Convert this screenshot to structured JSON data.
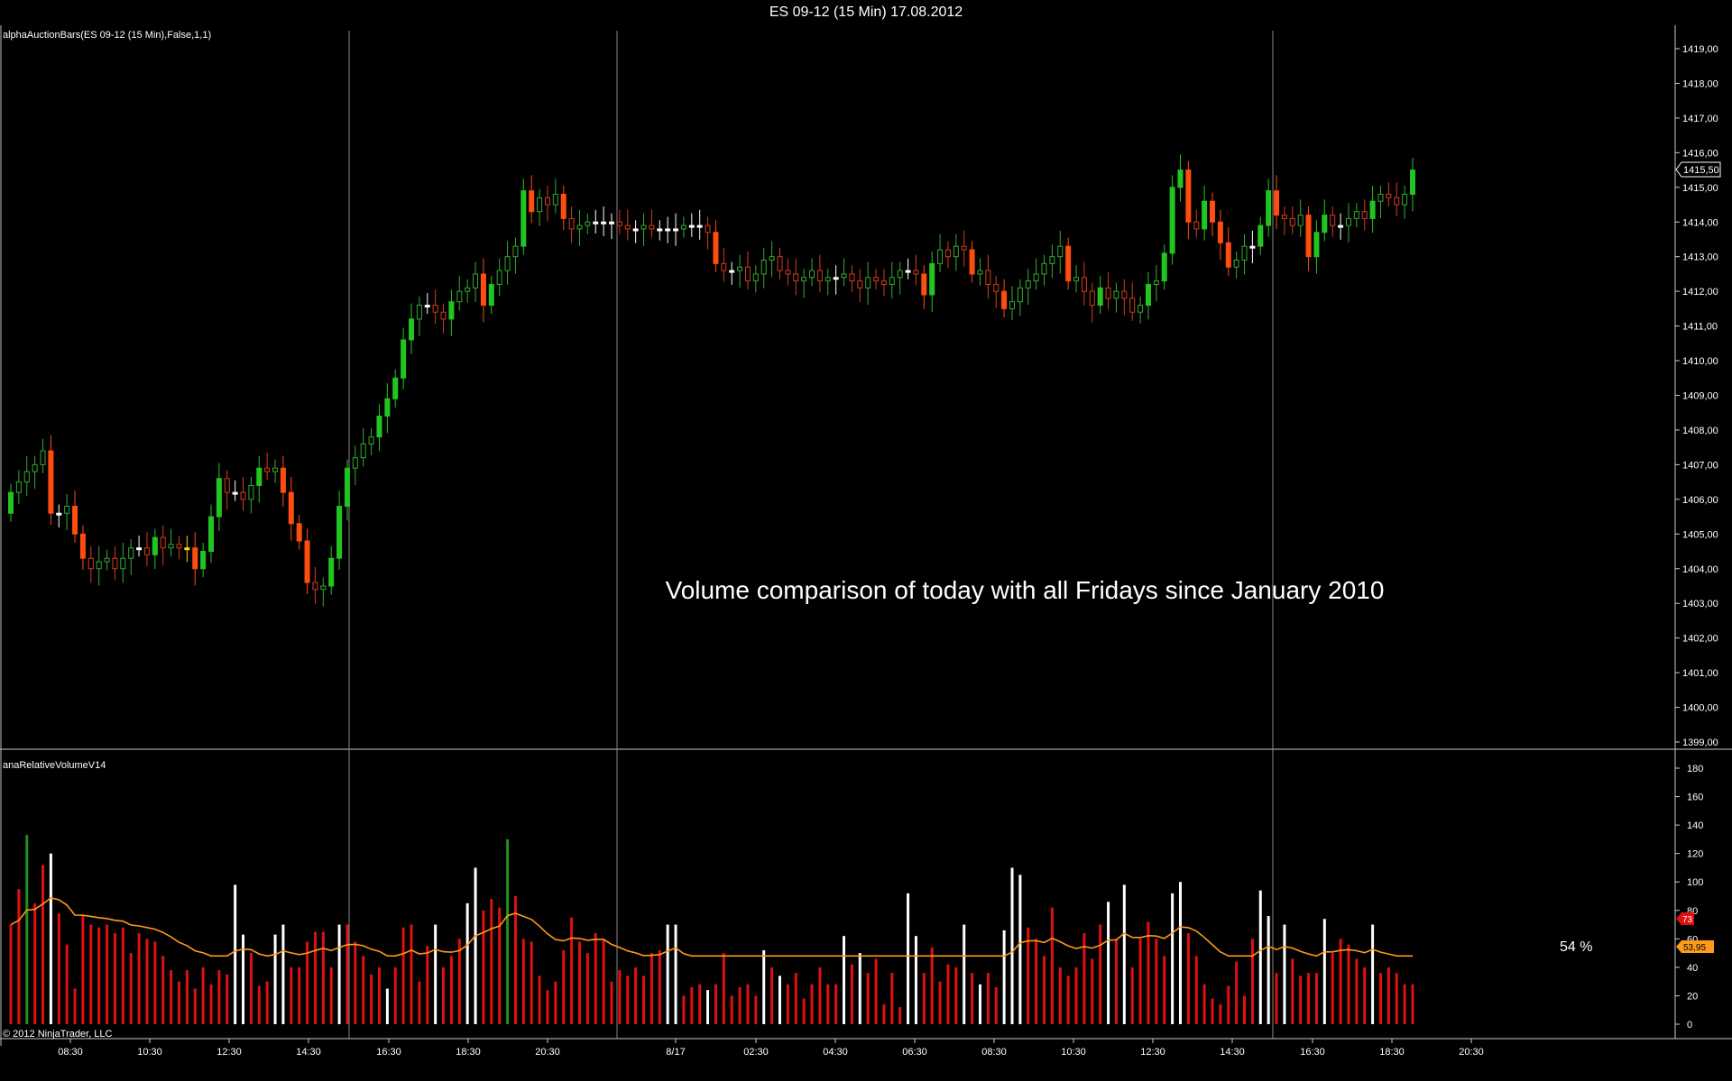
{
  "window": {
    "title": "ES 09-12 (15 Min)  17.08.2012"
  },
  "price_panel": {
    "indicator_label": "alphaAuctionBars(ES 09-12 (15 Min),False,1,1)",
    "annotation": "Volume comparison of today with all Fridays since January 2010",
    "last_price_tag": "1415,50"
  },
  "volume_panel": {
    "indicator_label": "anaRelativeVolumeV14",
    "percent_label": "54 %",
    "tag_red": "73",
    "tag_orange": "53,95",
    "copyright": "© 2012 NinjaTrader, LLC"
  },
  "colors": {
    "background": "#000000",
    "up_solid": "#22c422",
    "up_outline": "#33aa33",
    "down_solid": "#ff4c10",
    "down_outline": "#d23c1e",
    "doji": "#ffffff",
    "yellow": "#ffd400",
    "volume_red": "#e01010",
    "volume_white": "#ffffff",
    "volume_green": "#1f8f1f",
    "average_line": "#ff9a1a",
    "separator": "#888888"
  },
  "chart_data": [
    {
      "type": "candlestick",
      "title": "ES 09-12 (15 Min)  17.08.2012",
      "y_ticks": [
        "1419,00",
        "1418,00",
        "1417,00",
        "1416,00",
        "1415,00",
        "1414,00",
        "1413,00",
        "1412,00",
        "1411,00",
        "1410,00",
        "1409,00",
        "1408,00",
        "1407,00",
        "1406,00",
        "1405,00",
        "1404,00",
        "1403,00",
        "1402,00",
        "1401,00",
        "1400,00",
        "1399,00"
      ],
      "ylim": [
        1398.7,
        1419.4
      ],
      "x_ticks": [
        "08:30",
        "10:30",
        "12:30",
        "14:30",
        "16:30",
        "18:30",
        "20:30",
        "8/17",
        "02:30",
        "04:30",
        "06:30",
        "08:30",
        "10:30",
        "12:30",
        "14:30",
        "16:30",
        "18:30",
        "20:30"
      ],
      "last_price": 1415.5,
      "closes": [
        1406.2,
        1406.5,
        1406.8,
        1407.0,
        1407.4,
        1405.6,
        1405.6,
        1405.8,
        1405.0,
        1404.3,
        1404.0,
        1404.2,
        1404.3,
        1404.0,
        1404.3,
        1404.6,
        1404.6,
        1404.4,
        1404.9,
        1404.6,
        1404.7,
        1404.6,
        1404.6,
        1404.0,
        1404.5,
        1405.5,
        1406.6,
        1406.2,
        1406.2,
        1406.0,
        1406.4,
        1406.9,
        1406.8,
        1406.9,
        1406.2,
        1405.3,
        1404.8,
        1403.6,
        1403.4,
        1403.5,
        1404.3,
        1405.8,
        1406.9,
        1407.2,
        1407.6,
        1407.8,
        1408.4,
        1408.9,
        1409.5,
        1410.6,
        1411.2,
        1411.6,
        1411.6,
        1411.4,
        1411.2,
        1411.7,
        1412.0,
        1412.1,
        1412.5,
        1411.6,
        1412.2,
        1412.6,
        1413.0,
        1413.3,
        1414.9,
        1414.3,
        1414.7,
        1414.5,
        1414.8,
        1414.1,
        1413.8,
        1413.9,
        1414.0,
        1414.0,
        1414.0,
        1414.0,
        1413.9,
        1413.8,
        1413.8,
        1413.9,
        1413.8,
        1413.8,
        1413.8,
        1413.8,
        1413.9,
        1413.9,
        1413.9,
        1413.7,
        1412.8,
        1412.6,
        1412.6,
        1412.7,
        1412.3,
        1412.5,
        1412.9,
        1413.0,
        1412.6,
        1412.5,
        1412.3,
        1412.4,
        1412.6,
        1412.3,
        1412.4,
        1412.4,
        1412.5,
        1412.3,
        1412.1,
        1412.4,
        1412.3,
        1412.2,
        1412.4,
        1412.6,
        1412.6,
        1412.5,
        1411.9,
        1412.8,
        1413.2,
        1413.0,
        1413.3,
        1413.2,
        1412.5,
        1412.6,
        1412.2,
        1412.0,
        1411.5,
        1411.7,
        1412.1,
        1412.3,
        1412.5,
        1412.8,
        1413.0,
        1413.3,
        1412.3,
        1412.4,
        1412.0,
        1411.6,
        1412.1,
        1411.8,
        1412.0,
        1411.8,
        1411.4,
        1411.6,
        1412.2,
        1412.3,
        1413.1,
        1415.0,
        1415.5,
        1414.0,
        1413.8,
        1414.6,
        1414.0,
        1413.4,
        1412.7,
        1412.9,
        1413.3,
        1413.3,
        1413.9,
        1414.9,
        1414.2,
        1414.1,
        1413.9,
        1414.2,
        1413.0,
        1413.7,
        1414.2,
        1413.9,
        1413.9,
        1414.1,
        1414.3,
        1414.1,
        1414.6,
        1414.8,
        1414.7,
        1414.5,
        1414.8,
        1415.5
      ],
      "y_unit": "price"
    },
    {
      "type": "bar",
      "y_ticks": [
        "180",
        "160",
        "140",
        "120",
        "100",
        "80",
        "60",
        "40",
        "20",
        "0"
      ],
      "ylim": [
        0,
        180
      ],
      "series": [
        {
          "values": [
            70,
            95,
            133,
            85,
            112,
            120,
            78,
            56,
            25,
            76,
            70,
            68,
            70,
            64,
            68,
            50,
            64,
            60,
            58,
            48,
            38,
            30,
            38,
            25,
            40,
            28,
            38,
            35,
            98,
            63,
            50,
            27,
            30,
            63,
            70,
            40,
            40,
            58,
            65,
            65,
            40,
            70,
            70,
            58,
            48,
            35,
            40,
            25,
            40,
            68,
            70,
            30,
            55,
            70,
            40,
            48,
            60,
            85,
            110,
            80,
            88,
            82,
            130,
            90,
            60,
            58,
            34,
            24,
            30,
            52,
            75,
            58,
            50,
            64,
            60,
            30,
            38,
            34,
            40,
            34,
            50,
            52,
            70,
            70,
            20,
            26,
            28,
            24,
            28,
            50,
            20,
            26,
            28,
            20,
            52,
            40,
            34,
            28,
            36,
            18,
            28,
            40,
            28,
            28,
            62,
            42,
            50,
            36,
            46,
            14,
            36,
            12,
            92,
            62,
            36,
            54,
            30,
            42,
            40,
            70,
            36,
            28,
            36,
            26,
            66,
            110,
            105,
            68,
            60,
            48,
            82,
            40,
            34,
            40,
            64,
            46,
            70,
            86,
            60,
            98,
            40,
            60,
            72,
            60,
            48,
            92,
            100,
            64,
            48,
            28,
            18,
            14,
            27,
            44,
            20,
            60,
            94,
            76,
            36,
            70,
            46,
            34,
            36,
            36,
            74,
            50,
            60,
            56,
            46,
            40,
            70,
            36,
            40,
            36,
            28,
            28,
            28,
            40,
            48,
            30,
            34,
            26,
            38,
            24,
            36,
            28,
            32,
            42,
            48,
            56,
            58,
            74,
            76
          ]
        }
      ],
      "average_line_pct": 54
    }
  ]
}
